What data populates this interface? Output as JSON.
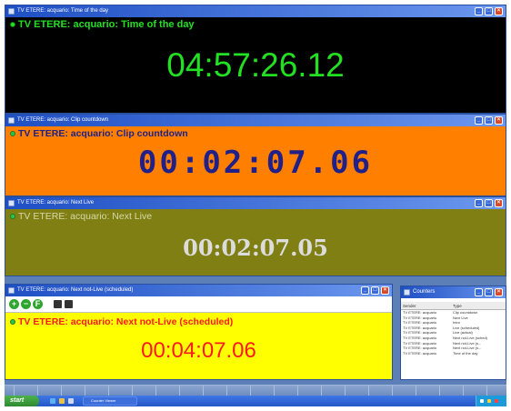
{
  "colors": {
    "timeofday_bg": "#000000",
    "timeofday_fg": "#22e022",
    "countdown_bg": "#ff8000",
    "countdown_fg": "#202088",
    "countdown_label": "#202088",
    "nextlive_bg": "#7f7f14",
    "nextlive_fg": "#dcdcdc",
    "nextlive_label": "#d8d8a8",
    "scheduled_bg": "#ffff00",
    "scheduled_fg": "#ff1a1a",
    "scheduled_label": "#ff1a1a"
  },
  "windows": {
    "timeofday": {
      "title": "TV ETERE: acquario: Time of the day",
      "label": "TV ETERE: acquario: Time of the day",
      "value": "04:57:26.12"
    },
    "countdown": {
      "title": "TV ETERE: acquario: Clip countdown",
      "label": "TV ETERE: acquario: Clip countdown",
      "value": "00:02:07.06"
    },
    "nextlive": {
      "title": "TV ETERE: acquario: Next Live",
      "label": "TV ETERE: acquario: Next Live",
      "value": "00:02:07.05"
    },
    "scheduled": {
      "title": "TV ETERE: acquario: Next not-Live (scheduled)",
      "label": "TV ETERE: acquario: Next not-Live (scheduled)",
      "value": "00:04:07.06"
    }
  },
  "counters": {
    "title": "Counters",
    "columns": [
      "Sender",
      "Type"
    ],
    "rows": [
      [
        "TV ETERE: acquario",
        "Clip countdown"
      ],
      [
        "TV ETERE: acquario",
        "Next Live"
      ],
      [
        "TV ETERE: acquario",
        "Intro"
      ],
      [
        "TV ETERE: acquario",
        "Live (scheduled)"
      ],
      [
        "TV ETERE: acquario",
        "Live (actual)"
      ],
      [
        "TV ETERE: acquario",
        "Next not-Live (sched)"
      ],
      [
        "TV ETERE: acquario",
        "Next not-Live (s..."
      ],
      [
        "TV ETERE: acquario",
        "Next not-Live (s..."
      ],
      [
        "TV ETERE: acquario",
        "Time of the day"
      ]
    ]
  },
  "taskbar": {
    "start_label": "start",
    "task_label": "Counter Viewer"
  }
}
